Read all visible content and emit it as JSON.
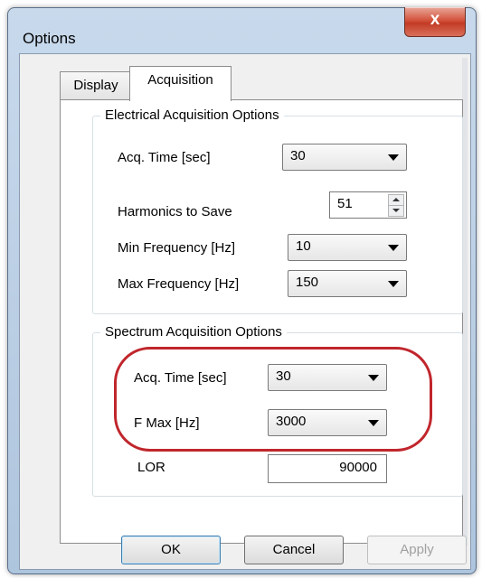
{
  "window": {
    "title": "Options",
    "close_glyph": "x"
  },
  "tabs": [
    {
      "label": "Display"
    },
    {
      "label": "Acquisition"
    }
  ],
  "electrical": {
    "legend": "Electrical Acquisition Options",
    "acq_time": {
      "label": "Acq. Time [sec]",
      "value": "30"
    },
    "harmonics": {
      "label": "Harmonics to Save",
      "value": "51"
    },
    "min_freq": {
      "label": "Min Frequency [Hz]",
      "value": "10"
    },
    "max_freq": {
      "label": "Max Frequency [Hz]",
      "value": "150"
    }
  },
  "spectrum": {
    "legend": "Spectrum Acquisition Options",
    "acq_time": {
      "label": "Acq. Time [sec]",
      "value": "30"
    },
    "f_max": {
      "label": "F Max [Hz]",
      "value": "3000"
    },
    "lor": {
      "label": "LOR",
      "value": "90000"
    }
  },
  "buttons": {
    "ok": "OK",
    "cancel": "Cancel",
    "apply": "Apply"
  },
  "colors": {
    "highlight": "#c0262c",
    "close_button": "#c23b25"
  }
}
